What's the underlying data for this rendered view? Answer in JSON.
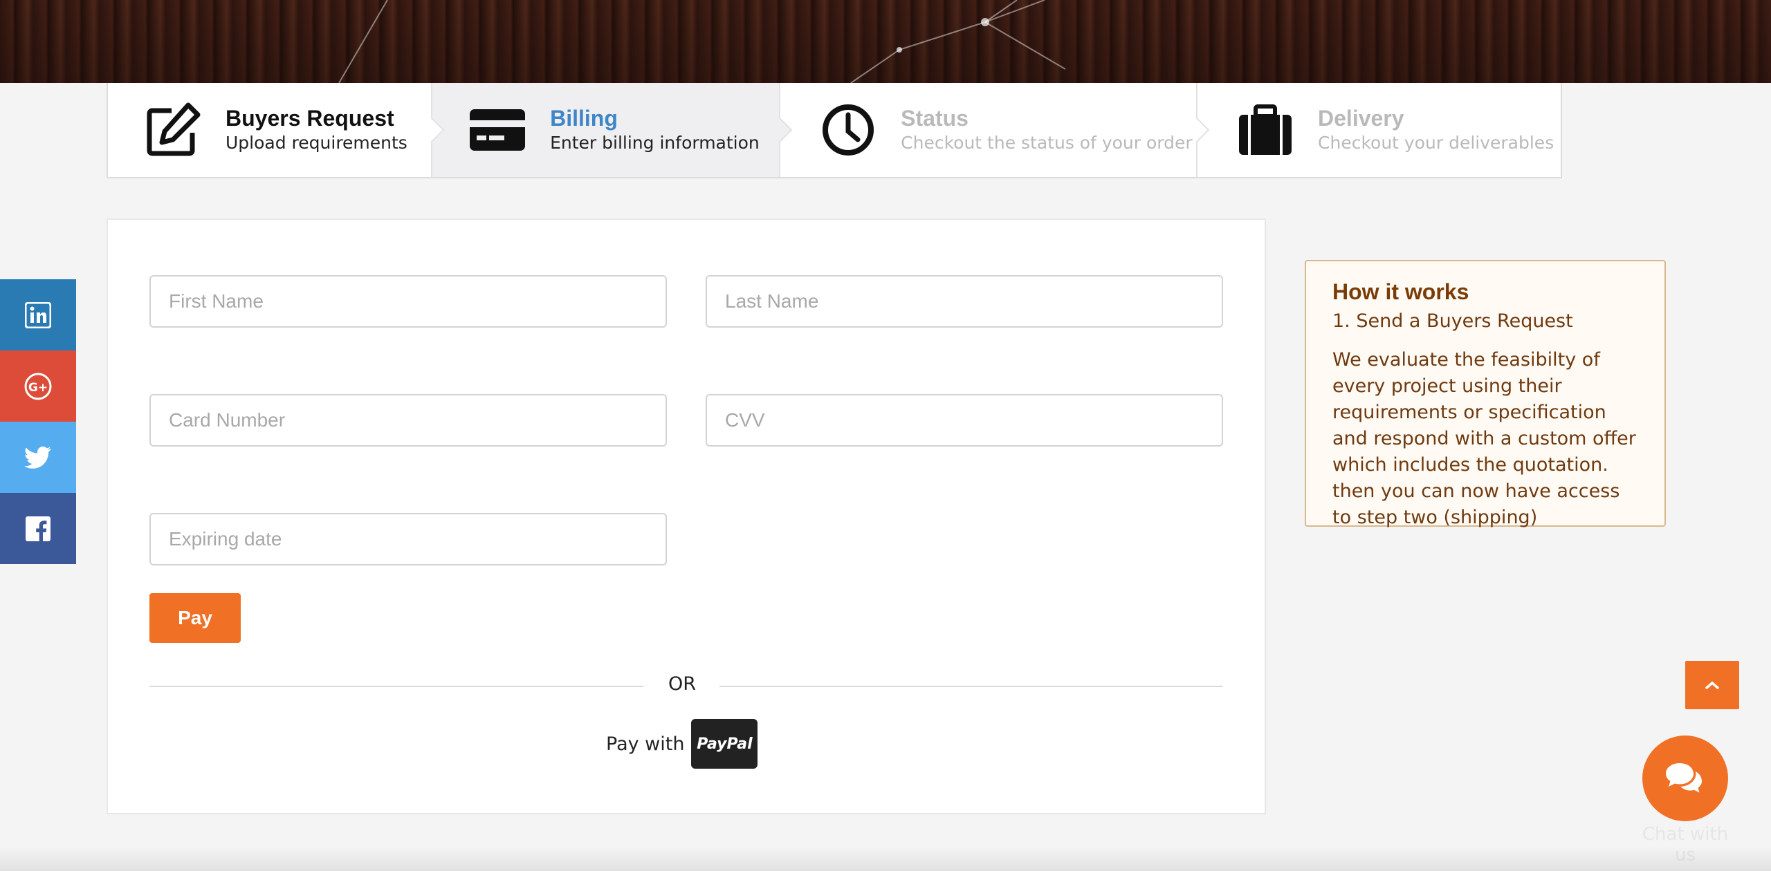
{
  "steps": [
    {
      "title": "Buyers Request",
      "subtitle": "Upload requirements",
      "icon": "edit-icon",
      "state": "done"
    },
    {
      "title": "Billing",
      "subtitle": "Enter billing information",
      "icon": "credit-card-icon",
      "state": "active"
    },
    {
      "title": "Status",
      "subtitle": "Checkout the status of your order",
      "icon": "clock-icon",
      "state": "pending"
    },
    {
      "title": "Delivery",
      "subtitle": "Checkout your deliverables",
      "icon": "briefcase-icon",
      "state": "pending"
    }
  ],
  "form": {
    "first_name": {
      "value": "",
      "placeholder": "First Name"
    },
    "last_name": {
      "value": "",
      "placeholder": "Last Name"
    },
    "card_number": {
      "value": "",
      "placeholder": "Card Number"
    },
    "cvv": {
      "value": "",
      "placeholder": "CVV"
    },
    "expiring_date": {
      "value": "",
      "placeholder": "Expiring date"
    },
    "pay_label": "Pay",
    "or_label": "OR",
    "pay_with_label": "Pay with",
    "paypal_label": "PayPal"
  },
  "how_it_works": {
    "title": "How it works",
    "step": "1. Send a Buyers Request",
    "body": "We evaluate the feasibilty of every project using their requirements or specification and respond with a custom offer which includes the quotation. then you can now have access to step two (shipping)"
  },
  "social": [
    {
      "name": "linkedin-icon",
      "color": "#2a7bb3"
    },
    {
      "name": "google-plus-icon",
      "color": "#dd4b39"
    },
    {
      "name": "twitter-icon",
      "color": "#55acee"
    },
    {
      "name": "facebook-icon",
      "color": "#3b5998"
    }
  ],
  "chat": {
    "label": "Chat with us"
  },
  "colors": {
    "accent": "#f07125",
    "active_step": "#3f86c8",
    "how_title": "#7a3c07"
  }
}
